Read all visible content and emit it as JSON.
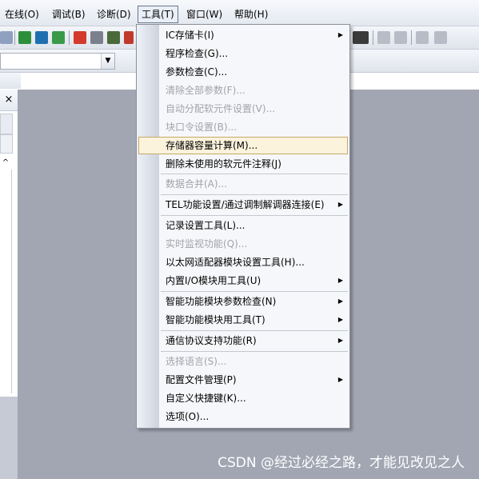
{
  "menubar": {
    "items": [
      {
        "label": "在线(O)"
      },
      {
        "label": "调试(B)"
      },
      {
        "label": "诊断(D)"
      },
      {
        "label": "工具(T)"
      },
      {
        "label": "窗口(W)"
      },
      {
        "label": "帮助(H)"
      }
    ]
  },
  "left_panel": {
    "close_glyph": "×",
    "scroll_up_glyph": "^"
  },
  "combo": {
    "arrow": "▼"
  },
  "tools_menu": {
    "items": [
      {
        "label": "IC存储卡(I)",
        "submenu": true,
        "enabled": true
      },
      {
        "label": "程序检查(G)...",
        "submenu": false,
        "enabled": true
      },
      {
        "label": "参数检查(C)...",
        "submenu": false,
        "enabled": true
      },
      {
        "label": "清除全部参数(F)...",
        "submenu": false,
        "enabled": false
      },
      {
        "label": "自动分配软元件设置(V)...",
        "submenu": false,
        "enabled": false
      },
      {
        "label": "块口令设置(B)...",
        "submenu": false,
        "enabled": false
      },
      {
        "label": "存储器容量计算(M)...",
        "submenu": false,
        "enabled": true,
        "highlighted": true
      },
      {
        "label": "删除未使用的软元件注释(J)",
        "submenu": false,
        "enabled": true
      },
      {
        "label": "数据合并(A)...",
        "submenu": false,
        "enabled": false
      },
      {
        "label": "TEL功能设置/通过调制解调器连接(E)",
        "submenu": true,
        "enabled": true
      },
      {
        "label": "记录设置工具(L)...",
        "submenu": false,
        "enabled": true
      },
      {
        "label": "实时监视功能(Q)...",
        "submenu": false,
        "enabled": false
      },
      {
        "label": "以太网适配器模块设置工具(H)...",
        "submenu": false,
        "enabled": true
      },
      {
        "label": "内置I/O模块用工具(U)",
        "submenu": true,
        "enabled": true
      },
      {
        "label": "智能功能模块参数检查(N)",
        "submenu": true,
        "enabled": true
      },
      {
        "label": "智能功能模块用工具(T)",
        "submenu": true,
        "enabled": true
      },
      {
        "label": "通信协议支持功能(R)",
        "submenu": true,
        "enabled": true
      },
      {
        "label": "选择语言(S)...",
        "submenu": false,
        "enabled": false
      },
      {
        "label": "配置文件管理(P)",
        "submenu": true,
        "enabled": true
      },
      {
        "label": "自定义快捷键(K)...",
        "submenu": false,
        "enabled": true
      },
      {
        "label": "选项(O)...",
        "submenu": false,
        "enabled": true
      }
    ],
    "submenu_glyph": "▶"
  },
  "watermark": "CSDN @经过必经之路，才能见改见之人"
}
